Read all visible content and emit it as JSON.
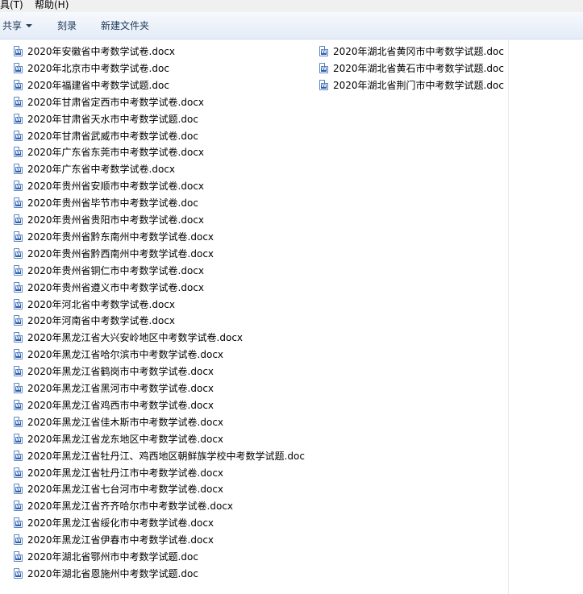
{
  "menubar": {
    "items": [
      "具(T)",
      "帮助(H)"
    ]
  },
  "toolbar": {
    "share_label": "共享",
    "burn_label": "刻录",
    "new_folder_label": "新建文件夹"
  },
  "files": {
    "icon": "word-doc-icon",
    "column1": [
      "2020年安徽省中考数学试卷.docx",
      "2020年北京市中考数学试卷.doc",
      "2020年福建省中考数学试题.doc",
      "2020年甘肃省定西市中考数学试卷.docx",
      "2020年甘肃省天水市中考数学试题.doc",
      "2020年甘肃省武威市中考数学试卷.doc",
      "2020年广东省东莞市中考数学试卷.docx",
      "2020年广东省中考数学试卷.docx",
      "2020年贵州省安顺市中考数学试卷.docx",
      "2020年贵州省毕节市中考数学试卷.doc",
      "2020年贵州省贵阳市中考数学试卷.docx",
      "2020年贵州省黔东南州中考数学试卷.docx",
      "2020年贵州省黔西南州中考数学试卷.docx",
      "2020年贵州省铜仁市中考数学试卷.docx",
      "2020年贵州省遵义市中考数学试卷.docx",
      "2020年河北省中考数学试卷.docx",
      "2020年河南省中考数学试卷.docx",
      "2020年黑龙江省大兴安岭地区中考数学试卷.docx",
      "2020年黑龙江省哈尔滨市中考数学试卷.docx",
      "2020年黑龙江省鹤岗市中考数学试卷.docx",
      "2020年黑龙江省黑河市中考数学试卷.docx",
      "2020年黑龙江省鸡西市中考数学试卷.docx",
      "2020年黑龙江省佳木斯市中考数学试卷.docx",
      "2020年黑龙江省龙东地区中考数学试卷.docx",
      "2020年黑龙江省牡丹江、鸡西地区朝鲜族学校中考数学试题.doc",
      "2020年黑龙江省牡丹江市中考数学试卷.docx",
      "2020年黑龙江省七台河市中考数学试卷.docx",
      "2020年黑龙江省齐齐哈尔市中考数学试卷.docx",
      "2020年黑龙江省绥化市中考数学试卷.docx",
      "2020年黑龙江省伊春市中考数学试卷.docx",
      "2020年湖北省鄂州市中考数学试题.doc",
      "2020年湖北省恩施州中考数学试题.doc"
    ],
    "column2": [
      "2020年湖北省黄冈市中考数学试题.doc",
      "2020年湖北省黄石市中考数学试题.doc",
      "2020年湖北省荆门市中考数学试题.doc"
    ]
  }
}
